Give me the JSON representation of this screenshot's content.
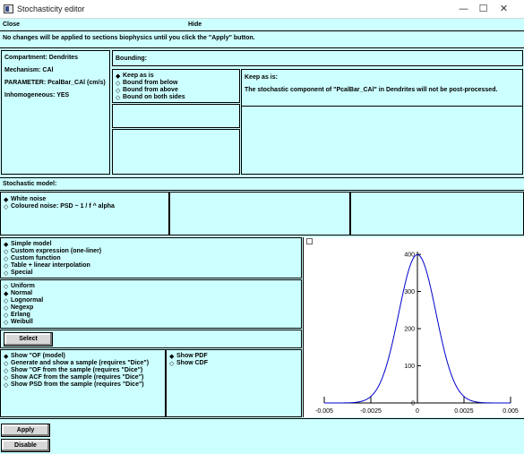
{
  "window": {
    "title": "Stochasticity editor",
    "minimize": "—",
    "maximize": "☐",
    "close": "✕"
  },
  "menu": {
    "close": "Close",
    "hide": "Hide"
  },
  "notice": "No changes will be applied to sections biophysics until you click the \"Apply\" button.",
  "info": {
    "compartment": "Compartment: Dendrites",
    "mechanism": "Mechanism: CAl",
    "parameter": "PARAMETER: PcalBar_CAl (cm/s)",
    "inhomogeneous": "Inhomogeneous: YES"
  },
  "bounding": {
    "header": "Bounding:",
    "options": [
      "Keep as is",
      "Bound from below",
      "Bound from above",
      "Bound on both sides"
    ],
    "selected_index": 0,
    "description_title": "Keep as is:",
    "description": "The stochastic component of \"PcalBar_CAl\" in Dendrites will not be post-processed."
  },
  "stochastic_model": {
    "header": "Stochastic model:",
    "options": [
      "White noise",
      "Coloured noise: PSD ~ 1 / f ^ alpha"
    ],
    "selected_index": 0
  },
  "model_type": {
    "options": [
      "Simple model",
      "Custom expression (one-liner)",
      "Custom function",
      "Table + linear interpolation",
      "Special"
    ],
    "selected_index": 0
  },
  "distribution": {
    "options": [
      "Uniform",
      "Normal",
      "Lognormal",
      "Negexp",
      "Erlang",
      "Weibull"
    ],
    "selected_index": 1
  },
  "select_button": "Select",
  "show_options": {
    "options": [
      "Show \"OF (model)",
      "Generate and show a sample (requires \"Dice\")",
      "Show \"OF from the sample (requires \"Dice\")",
      "Show ACF from the sample (requires \"Dice\")",
      "Show PSD from the sample (requires \"Dice\")"
    ],
    "selected_index": 0
  },
  "pdf_cdf": {
    "options": [
      "Show PDF",
      "Show CDF"
    ],
    "selected_index": 0
  },
  "buttons": {
    "apply": "Apply",
    "disable": "Disable"
  },
  "chart_data": {
    "type": "line",
    "title": "",
    "xlabel": "",
    "ylabel": "",
    "x_ticks": [
      "-0.005",
      "-0.0025",
      "0",
      "0.0025",
      "0.005"
    ],
    "y_ticks": [
      "0",
      "100",
      "200",
      "300",
      "400"
    ],
    "xlim": [
      -0.005,
      0.005
    ],
    "ylim": [
      0,
      400
    ],
    "series": [
      {
        "color": "#0000cc",
        "x": [
          -0.005,
          -0.0045,
          -0.004,
          -0.0035,
          -0.003,
          -0.0025,
          -0.002,
          -0.0015,
          -0.001,
          -0.0005,
          0,
          0.0005,
          0.001,
          0.0015,
          0.002,
          0.0025,
          0.003,
          0.0035,
          0.004,
          0.0045,
          0.005
        ],
        "y": [
          0.0,
          0.1,
          0.3,
          0.9,
          4.4,
          17.5,
          54,
          130,
          242,
          352,
          399,
          352,
          242,
          130,
          54,
          17.5,
          4.4,
          0.9,
          0.3,
          0.1,
          0.0
        ]
      }
    ]
  }
}
